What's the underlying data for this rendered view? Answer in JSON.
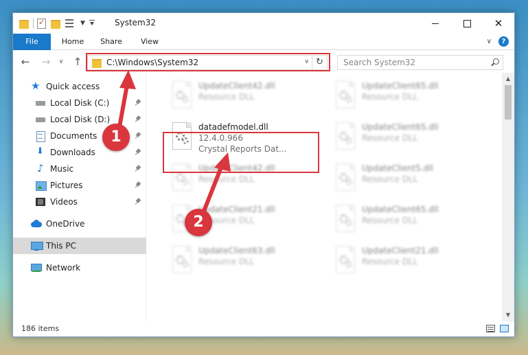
{
  "window": {
    "title": "System32"
  },
  "ribbon": {
    "tabs": [
      "File",
      "Home",
      "Share",
      "View"
    ]
  },
  "navigation": {
    "address": "C:\\Windows\\System32",
    "search_placeholder": "Search System32"
  },
  "sidebar": {
    "items": [
      {
        "label": "Quick access",
        "icon": "star-icon",
        "pinned": false
      },
      {
        "label": "Local Disk (C:)",
        "icon": "disk-icon",
        "pinned": true
      },
      {
        "label": "Local Disk (D:)",
        "icon": "disk-icon",
        "pinned": true
      },
      {
        "label": "Documents",
        "icon": "documents-icon",
        "pinned": true
      },
      {
        "label": "Downloads",
        "icon": "downloads-icon",
        "pinned": true
      },
      {
        "label": "Music",
        "icon": "music-icon",
        "pinned": true
      },
      {
        "label": "Pictures",
        "icon": "pictures-icon",
        "pinned": true
      },
      {
        "label": "Videos",
        "icon": "videos-icon",
        "pinned": true
      },
      {
        "label": "OneDrive",
        "icon": "onedrive-icon",
        "pinned": false
      },
      {
        "label": "This PC",
        "icon": "this-pc-icon",
        "pinned": false,
        "selected": true
      },
      {
        "label": "Network",
        "icon": "network-icon",
        "pinned": false
      }
    ]
  },
  "files": {
    "left": [
      {
        "name": "UpdateClient42.dll",
        "line2": "Resource DLL",
        "line3": ""
      },
      {
        "name": "datadefmodel.dll",
        "line2": "12.4.0.966",
        "line3": "Crystal Reports Dat..."
      },
      {
        "name": "UpdateClient42.dll",
        "line2": "Resource DLL",
        "line3": ""
      },
      {
        "name": "UpdateClient21.dll",
        "line2": "Resource DLL",
        "line3": ""
      },
      {
        "name": "UpdateClient63.dll",
        "line2": "Resource DLL",
        "line3": ""
      }
    ],
    "right": [
      {
        "name": "UpdateClient65.dll",
        "line2": "Resource DLL"
      },
      {
        "name": "UpdateClient65.dll",
        "line2": "Resource DLL"
      },
      {
        "name": "UpdateClient5.dll",
        "line2": "Resource DLL"
      },
      {
        "name": "UpdateClient65.dll",
        "line2": "Resource DLL"
      },
      {
        "name": "UpdateClient21.dll",
        "line2": "Resource DLL"
      }
    ]
  },
  "status": {
    "item_count": "186 items"
  },
  "annotations": {
    "step1": "1",
    "step2": "2",
    "color": "#d9363e"
  }
}
